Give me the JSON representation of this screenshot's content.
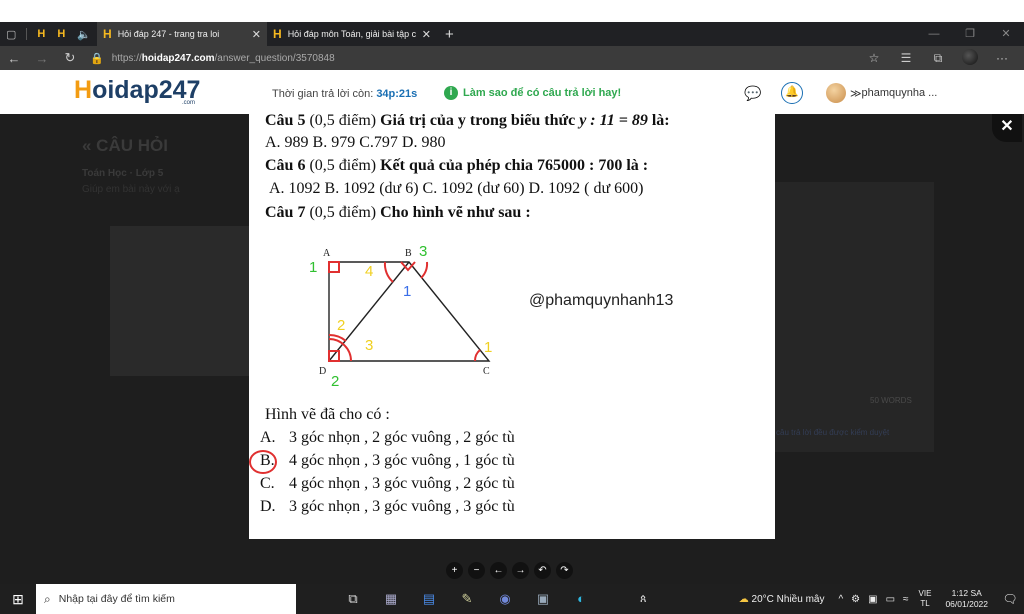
{
  "browser": {
    "tabs": [
      {
        "title": "Hỏi đáp 247 - trang tra loi",
        "active": true
      },
      {
        "title": "Hỏi đáp môn Toán, giải bài tập c",
        "active": false
      }
    ],
    "url_prefix": "https://",
    "url_host": "hoidap247.com",
    "url_path": "/answer_question/3570848"
  },
  "site": {
    "logo_main": "oidap247",
    "logo_h": "H",
    "logo_sub": ".com",
    "timer_label": "Thời gian trả lời còn:",
    "timer_value": "34p:21s",
    "tip": "Làm sao để có câu trả lời hay!",
    "username": "phamquynha ...",
    "user_prefix": "≫"
  },
  "background_page": {
    "title": "« CÂU HỎI",
    "subject": "Toán Học · Lớp 5",
    "subtitle": "Giúp em bài này với ạ",
    "words": "50 WORDS",
    "note": "câu trả lời đều được kiểm duyệt"
  },
  "image_content": {
    "q5_label": "Câu 5",
    "q5_points": " (0,5 điểm) ",
    "q5_text": "Giá trị của  y trong biểu thức ",
    "q5_expr": "y : 11 = 89",
    "q5_end": " là:",
    "q5_options": "A. 989          B. 979          C.797   D. 980",
    "q6_label": "Câu 6",
    "q6_points": " (0,5 điểm) ",
    "q6_text": "Kết quả của phép chia 765000 : 700 là :",
    "q6_options": "A. 1092    B. 1092 (dư 6)   C. 1092 (dư 60)  D. 1092 ( dư 600)",
    "q7_label": "Câu 7",
    "q7_points": " (0,5 điểm) ",
    "q7_text": "Cho hình vẽ như sau :",
    "watermark": "@phamquynhanh13",
    "figure": {
      "vertex_a": "A",
      "vertex_b": "B",
      "vertex_c": "C",
      "vertex_d": "D",
      "n_1": "1",
      "n_2": "2",
      "n_3": "3",
      "n_4": "4"
    },
    "answer_intro": "Hình vẽ đã cho có :",
    "answers": [
      {
        "key": "A.",
        "text": "3 góc nhọn , 2 góc vuông , 2 góc tù"
      },
      {
        "key": "B.",
        "text": "4 góc nhọn , 3 góc vuông , 1 góc tù"
      },
      {
        "key": "C.",
        "text": "4 góc nhọn , 3 góc vuông , 2 góc tù"
      },
      {
        "key": "D.",
        "text": "3 góc nhọn , 3 góc vuông , 3 góc tù"
      }
    ],
    "selected_answer": "B."
  },
  "taskbar": {
    "search_placeholder": "Nhập tại đây để tìm kiếm",
    "weather": "20°C  Nhiều mây",
    "lang_top": "VIE",
    "lang_bottom": "TL",
    "time": "1:12 SA",
    "date": "06/01/2022"
  },
  "colors": {
    "accent_blue": "#1a6fb3",
    "brand_orange": "#f39c12",
    "tip_green": "#2fa84f",
    "highlight_red": "#e03030"
  }
}
